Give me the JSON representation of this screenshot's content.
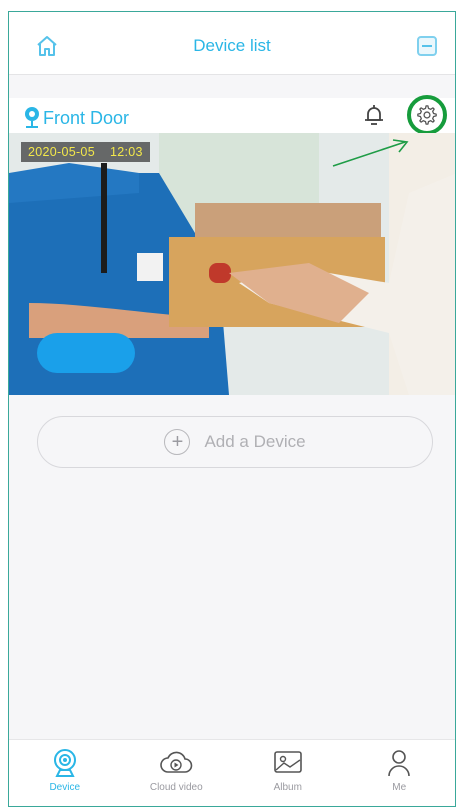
{
  "header": {
    "title": "Device list"
  },
  "device": {
    "name": "Front Door",
    "timestamp": "2020-05-05    12:03"
  },
  "add_device": {
    "label": "Add a Device"
  },
  "tabs": [
    {
      "label": "Device",
      "active": true
    },
    {
      "label": "Cloud video",
      "active": false
    },
    {
      "label": "Album",
      "active": false
    },
    {
      "label": "Me",
      "active": false
    }
  ],
  "colors": {
    "accent": "#2ab6e6",
    "highlight_ring": "#169c3c",
    "pill": "#1aa0ea"
  }
}
